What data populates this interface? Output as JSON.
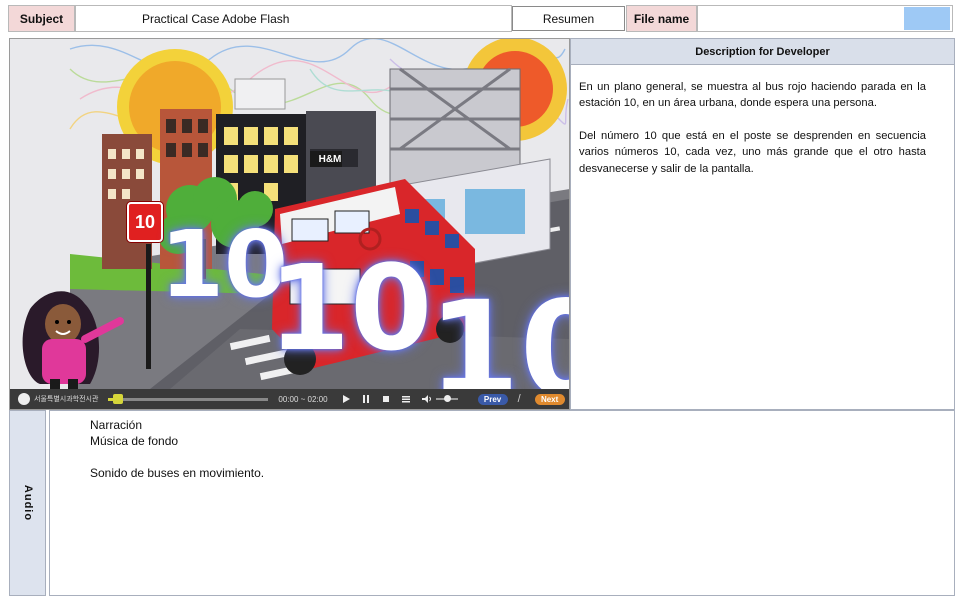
{
  "header": {
    "subject_label": "Subject",
    "subject_value": "Practical Case Adobe Flash",
    "resumen_label": "Resumen",
    "filename_label": "File name",
    "filename_value": "",
    "swatch_color": "#9ec9f5"
  },
  "scene": {
    "bus_sign": "H&M",
    "stop_number": "10",
    "floating_numbers": [
      "10",
      "10",
      "10"
    ]
  },
  "player": {
    "logo_text": "서울특별시과학전시관",
    "time": "00:00 ~ 02:00",
    "progress": 0.03,
    "volume": 0.5,
    "prev_label": "Prev",
    "separator": "/",
    "next_label": "Next",
    "accent": "#e08a2e"
  },
  "description": {
    "title": "Description for Developer",
    "paragraphs": [
      "En un plano general,  se muestra al bus rojo haciendo parada en la estación 10, en un área urbana, donde espera una persona.",
      "Del número 10 que está en el poste se desprenden en secuencia varios números 10, cada vez, uno más grande que el otro hasta desvanecerse y salir de la pantalla."
    ]
  },
  "audio": {
    "label": "Audio",
    "lines": [
      "Narración",
      "Música de fondo",
      "",
      "Sonido de buses en movimiento."
    ]
  }
}
